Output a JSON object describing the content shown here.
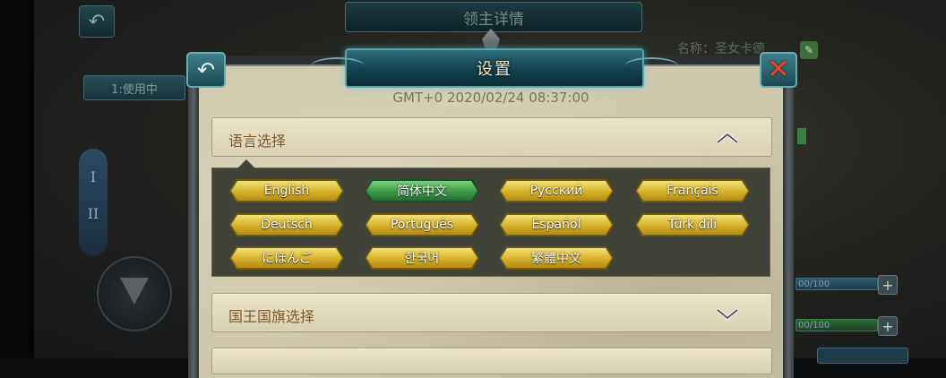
{
  "background": {
    "top_title": "领主详情",
    "in_use_label": "1:使用中",
    "name_label": "名称：圣女卡德",
    "roman_numerals": [
      "I",
      "II"
    ],
    "bar1_text": "00/100",
    "bar2_text": "00/100"
  },
  "dialog": {
    "title": "设置",
    "timestamp": "GMT+0  2020/02/24  08:37:00"
  },
  "language_section": {
    "title": "语言选择",
    "expanded": true,
    "selected": "简体中文",
    "languages": [
      {
        "label": "English",
        "selected": false
      },
      {
        "label": "简体中文",
        "selected": true
      },
      {
        "label": "Русский",
        "selected": false
      },
      {
        "label": "Français",
        "selected": false
      },
      {
        "label": "Deutsch",
        "selected": false
      },
      {
        "label": "Português",
        "selected": false
      },
      {
        "label": "Español",
        "selected": false
      },
      {
        "label": "Türk dili",
        "selected": false
      },
      {
        "label": "にほんご",
        "selected": false
      },
      {
        "label": "한국어",
        "selected": false
      },
      {
        "label": "繁體中文",
        "selected": false
      }
    ]
  },
  "flag_section": {
    "title": "国王国旗选择",
    "expanded": false
  },
  "colors": {
    "active_button": "#3f9c49",
    "gold_button": "#d9b52d",
    "header_text": "#80582e"
  },
  "icons": {
    "back": "back-arrow-icon",
    "close": "close-x-icon",
    "collapse": "chevron-up-icon",
    "expand": "chevron-down-icon"
  }
}
